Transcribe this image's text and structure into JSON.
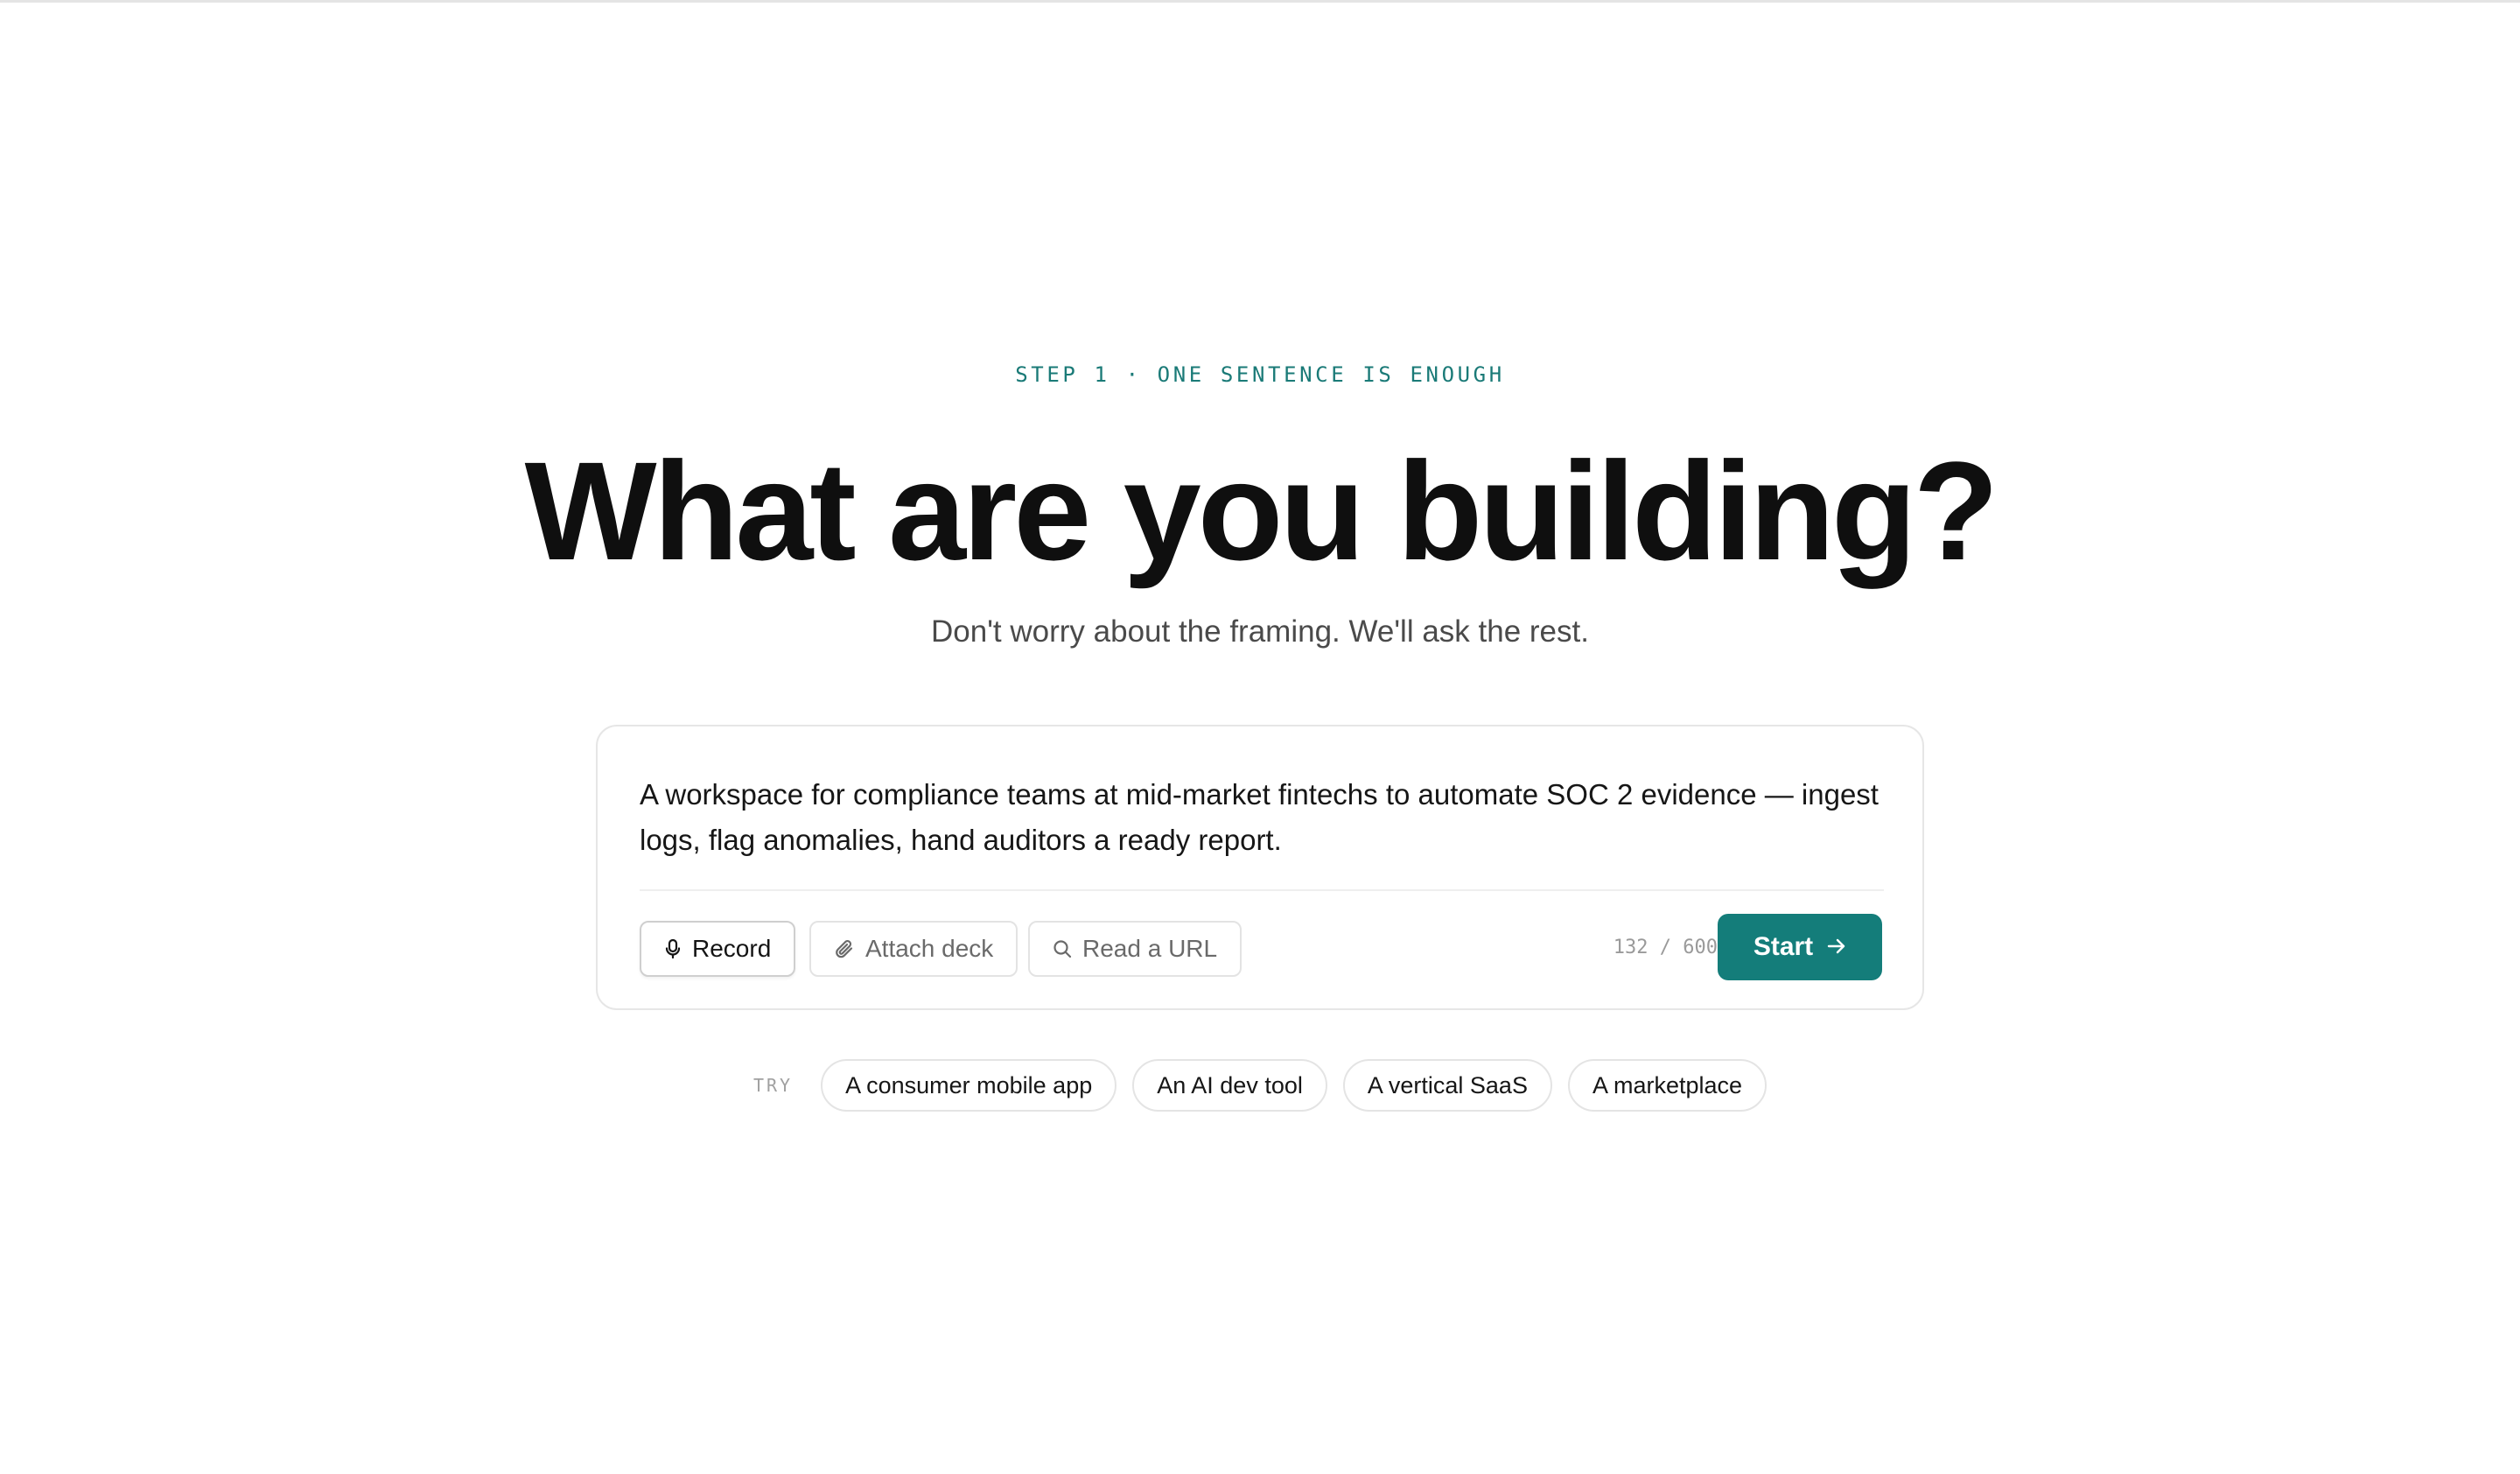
{
  "hero": {
    "step_label": "STEP 1 · ONE SENTENCE IS ENOUGH",
    "title": "What are you building?",
    "subtitle": "Don't worry about the framing. We'll ask the rest."
  },
  "composer": {
    "value": "A workspace for compliance teams at mid-market fintechs to automate SOC 2 evidence — ingest logs, flag anomalies, hand auditors a ready report.",
    "tools": {
      "record_label": "Record",
      "attach_label": "Attach deck",
      "url_label": "Read a URL"
    },
    "char_count": "132 / 600",
    "start_label": "Start"
  },
  "suggestions": {
    "label": "TRY",
    "items": [
      "A consumer mobile app",
      "An AI dev tool",
      "A vertical SaaS",
      "A marketplace"
    ]
  },
  "icons": {
    "record": "microphone-icon",
    "attach": "paperclip-icon",
    "url": "search-icon",
    "start": "arrow-right-icon"
  },
  "colors": {
    "accent": "#147d7a",
    "step_label": "#1a7a77"
  }
}
